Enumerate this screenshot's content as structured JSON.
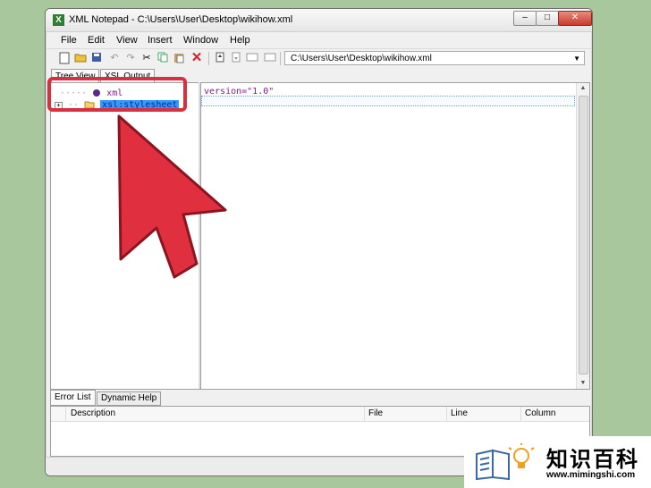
{
  "window": {
    "title": "XML Notepad - C:\\Users\\User\\Desktop\\wikihow.xml",
    "app_icon": "X",
    "minimize_glyph": "–",
    "maximize_glyph": "□",
    "close_glyph": "✕"
  },
  "menu": [
    "File",
    "Edit",
    "View",
    "Insert",
    "Window",
    "Help"
  ],
  "toolbar": {
    "icons": [
      "new-icon",
      "open-icon",
      "save-icon",
      "undo-icon",
      "redo-icon",
      "cut-icon",
      "copy-icon",
      "paste-icon",
      "delete-icon",
      "nudge-up-icon",
      "nudge-down-icon",
      "nudge-left-icon",
      "nudge-right-icon"
    ],
    "path": "C:\\Users\\User\\Desktop\\wikihow.xml"
  },
  "tabs_top": [
    "Tree View",
    "XSL Output"
  ],
  "tree": [
    {
      "label": "xml",
      "icon": "processing-instruction-icon",
      "selected": false
    },
    {
      "label": "xsl:stylesheet",
      "icon": "folder-icon",
      "selected": true,
      "expander": "+"
    }
  ],
  "value_pane": {
    "row1": "version=\"1.0\""
  },
  "bottom_tabs": [
    "Error List",
    "Dynamic Help"
  ],
  "error_list_columns": [
    "Description",
    "File",
    "Line",
    "Column"
  ],
  "brand": {
    "name_cn": "知识百科",
    "url": "www.mimingshi.com"
  },
  "colors": {
    "callout": "#d8303f",
    "selection": "#3399ff",
    "background": "#a9c79c"
  }
}
